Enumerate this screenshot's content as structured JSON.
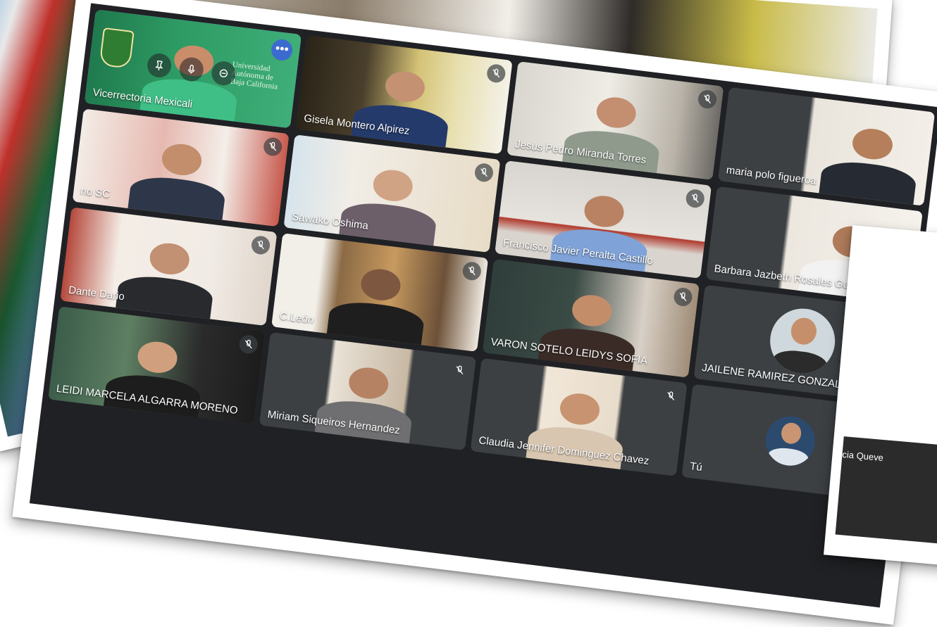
{
  "main_grid": {
    "tiles": [
      {
        "name": "Vicerrectoria Mexicali",
        "overlay_text": "Universidad Autónoma de Baja California",
        "active": true,
        "menu": "•••"
      },
      {
        "name": "Gisela Montero Alpirez",
        "muted": true
      },
      {
        "name": "Jesus Pedro Miranda Torres",
        "muted": true
      },
      {
        "name": "maria polo figueroa"
      },
      {
        "name": "no SC",
        "muted": true
      },
      {
        "name": "Sawako Oshima",
        "muted": true
      },
      {
        "name": "Francisco Javier Peralta Castillo",
        "muted": true
      },
      {
        "name": "Barbara Jazbeth Rosales Gui"
      },
      {
        "name": "Dante Dario",
        "muted": true
      },
      {
        "name": "C.León",
        "muted": true
      },
      {
        "name": "VARON SOTELO LEIDYS SOFIA",
        "muted": true
      },
      {
        "name": "JAILENE RAMIREZ GONZALE"
      },
      {
        "name": "LEIDI MARCELA ALGARRA MORENO",
        "muted": true
      },
      {
        "name": "Miriam Siqueiros Hernandez",
        "muted": true
      },
      {
        "name": "Claudia Jennifer Dominguez Chavez",
        "muted": true
      },
      {
        "name": "Tú"
      }
    ]
  },
  "right_photo": {
    "caption": "cia Queve"
  },
  "colors": {
    "grid_bg": "#202124",
    "tile_bg": "#3c4043",
    "active_outline": "#8ab4f8"
  }
}
